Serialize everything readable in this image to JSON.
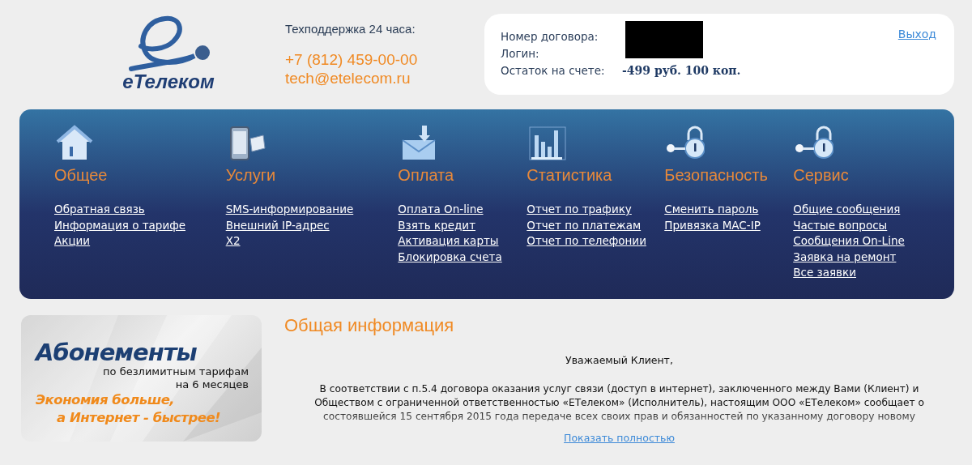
{
  "logo": {
    "name": "еТелеком"
  },
  "support": {
    "label": "Техподдержка 24 часа:",
    "phone": "+7 (812) 459-00-00",
    "email": "tech@etelecom.ru"
  },
  "account": {
    "fields": [
      {
        "label": "Номер договора:"
      },
      {
        "label": "Логин:"
      },
      {
        "label": "Остаток на счете:",
        "value": "-499 руб. 100 коп."
      }
    ],
    "logout": "Выход"
  },
  "menu": [
    {
      "title": "Общее",
      "links": [
        "Обратная связь",
        "Информация о тарифе",
        "Акции"
      ]
    },
    {
      "title": "Услуги",
      "links": [
        "SMS-информирование",
        "Внешний IP-адрес",
        "X2"
      ]
    },
    {
      "title": "Оплата",
      "links": [
        "Оплата On-line",
        "Взять кредит",
        "Активация карты",
        "Блокировка счета"
      ]
    },
    {
      "title": "Статистика",
      "links": [
        "Отчет по трафику",
        "Отчет по платежам",
        "Отчет по телефонии"
      ]
    },
    {
      "title": "Безопасность",
      "links": [
        "Сменить пароль",
        "Привязка MAC-IP"
      ]
    },
    {
      "title": "Сервис",
      "links": [
        "Общие сообщения",
        "Частые вопросы",
        "Сообщения On-Line",
        "Заявка на ремонт",
        "Все заявки"
      ]
    }
  ],
  "banner": {
    "title": "Абонементы",
    "subtitle_1": "по безлимитным тарифам",
    "subtitle_2": "на 6 месяцев",
    "slogan_1": "Экономия больше,",
    "slogan_2": "а Интернет - быстрее!"
  },
  "info": {
    "heading": "Общая информация",
    "greeting": "Уважаемый Клиент,",
    "body": "В соответствии с п.5.4 договора оказания услуг связи (доступ в интернет), заключенного между Вами (Клиент) и Обществом с ограниченной ответственностью «ЕТелеком» (Исполнитель), настоящим ООО «ЕТелеком» сообщает о состоявшейся 15 сентября 2015 года передаче всех своих прав и обязанностей по указанному договору новому",
    "more_link": "Показать полностью"
  }
}
